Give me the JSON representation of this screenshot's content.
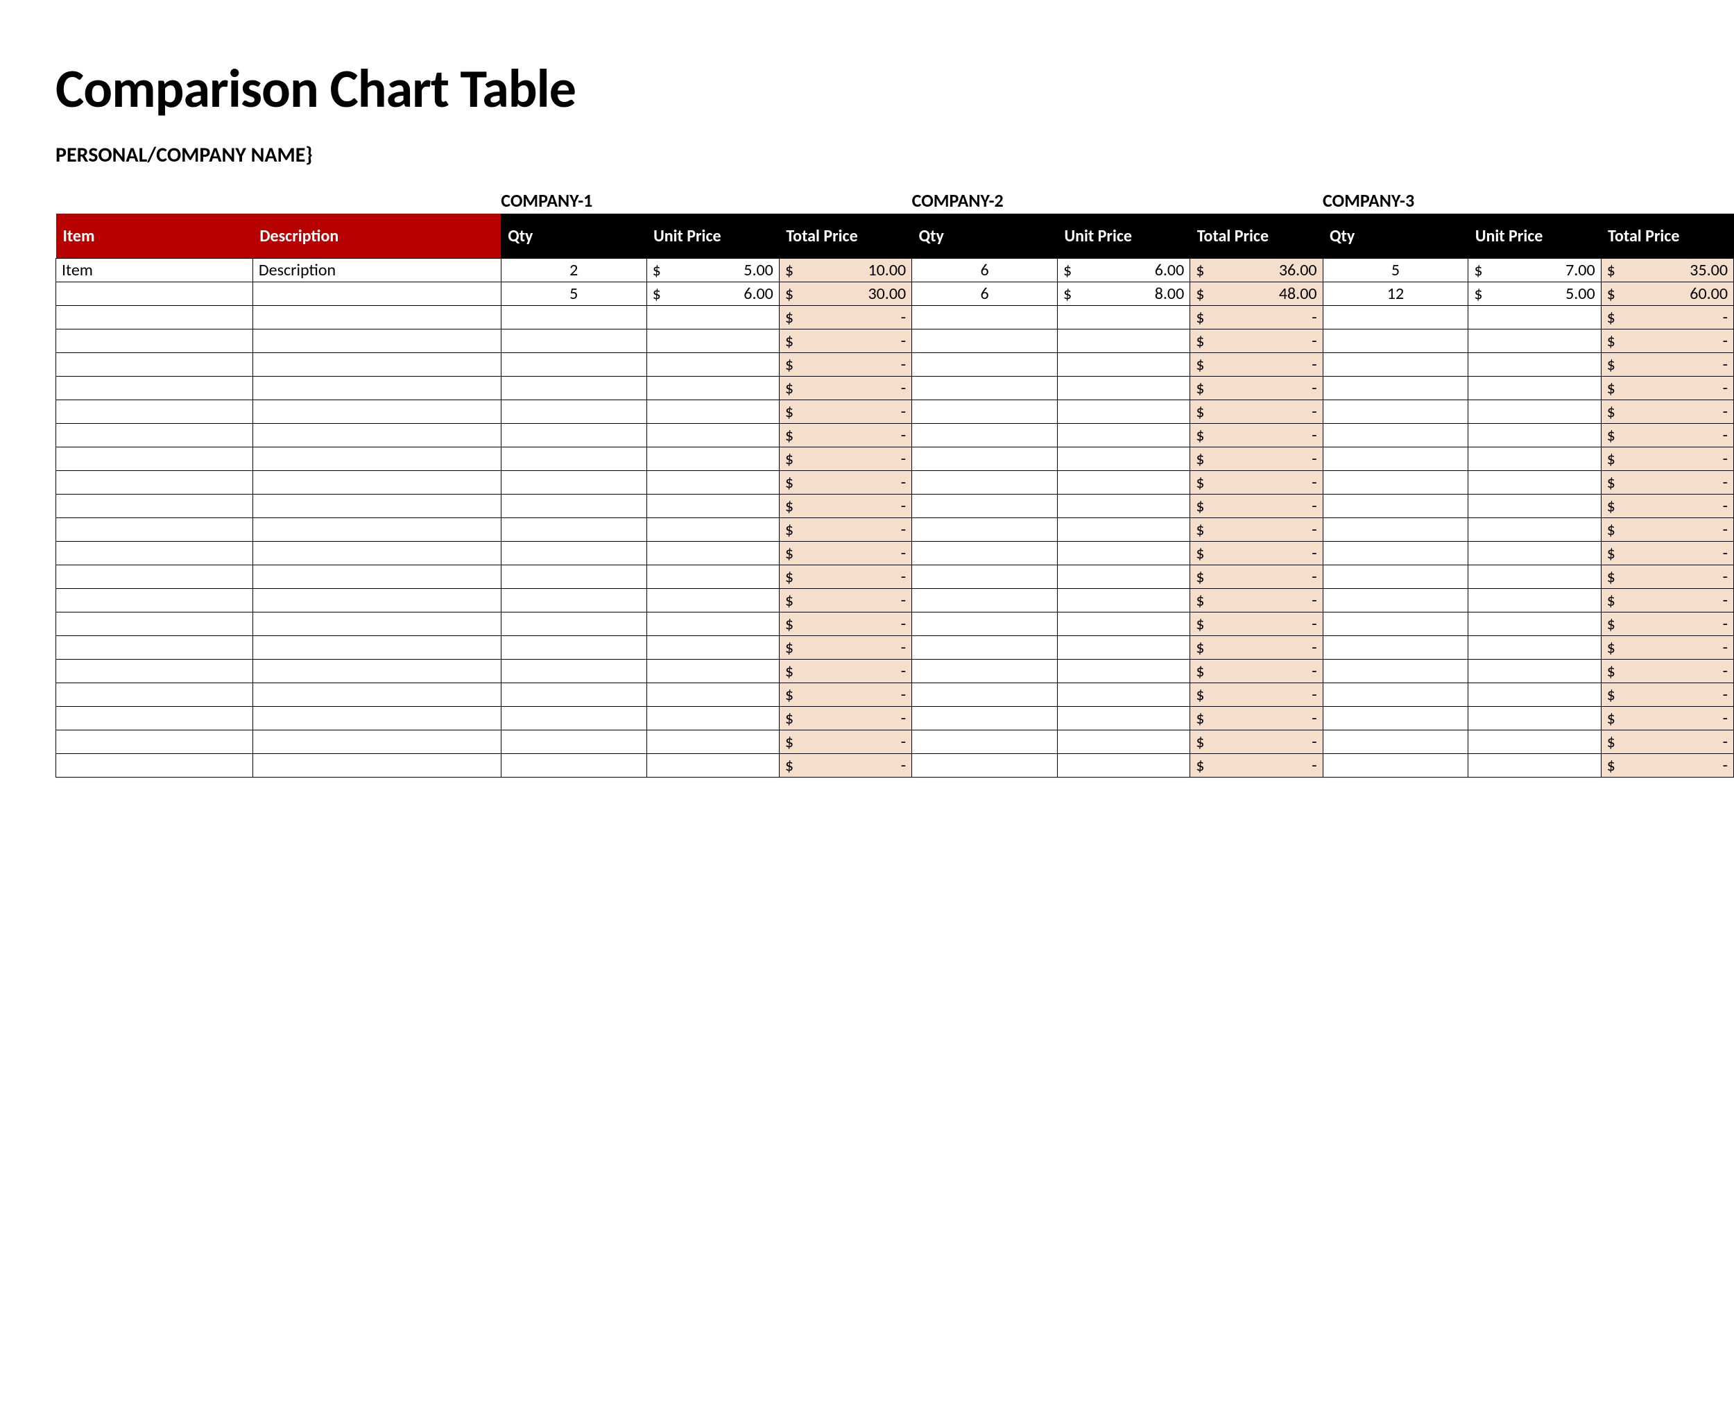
{
  "title": "Comparison Chart Table",
  "subtitle": "PERSONAL/COMPANY NAME}",
  "currency_symbol": "$",
  "dash": "-",
  "companies": [
    {
      "label": "COMPANY-1"
    },
    {
      "label": "COMPANY-2"
    },
    {
      "label": "COMPANY-3"
    }
  ],
  "headers": {
    "item": "Item",
    "description": "Description",
    "qty": "Qty",
    "unit_price": "Unit Price",
    "total_price": "Total Price"
  },
  "rows": [
    {
      "item": "Item",
      "description": "Description",
      "companies": [
        {
          "qty": "2",
          "unit": "5.00",
          "total": "10.00"
        },
        {
          "qty": "6",
          "unit": "6.00",
          "total": "36.00"
        },
        {
          "qty": "5",
          "unit": "7.00",
          "total": "35.00"
        }
      ]
    },
    {
      "item": "",
      "description": "",
      "companies": [
        {
          "qty": "5",
          "unit": "6.00",
          "total": "30.00"
        },
        {
          "qty": "6",
          "unit": "8.00",
          "total": "48.00"
        },
        {
          "qty": "12",
          "unit": "5.00",
          "total": "60.00"
        }
      ]
    }
  ],
  "empty_row_count": 20,
  "chart_data": {
    "type": "table",
    "title": "Comparison Chart Table",
    "columns": [
      "Item",
      "Description",
      "Qty",
      "Unit Price",
      "Total Price"
    ],
    "series": [
      {
        "name": "COMPANY-1",
        "rows": [
          {
            "item": "Item",
            "description": "Description",
            "qty": 2,
            "unit_price": 5.0,
            "total_price": 10.0
          },
          {
            "item": "",
            "description": "",
            "qty": 5,
            "unit_price": 6.0,
            "total_price": 30.0
          }
        ]
      },
      {
        "name": "COMPANY-2",
        "rows": [
          {
            "item": "Item",
            "description": "Description",
            "qty": 6,
            "unit_price": 6.0,
            "total_price": 36.0
          },
          {
            "item": "",
            "description": "",
            "qty": 6,
            "unit_price": 8.0,
            "total_price": 48.0
          }
        ]
      },
      {
        "name": "COMPANY-3",
        "rows": [
          {
            "item": "Item",
            "description": "Description",
            "qty": 5,
            "unit_price": 7.0,
            "total_price": 35.0
          },
          {
            "item": "",
            "description": "",
            "qty": 12,
            "unit_price": 5.0,
            "total_price": 60.0
          }
        ]
      }
    ]
  }
}
